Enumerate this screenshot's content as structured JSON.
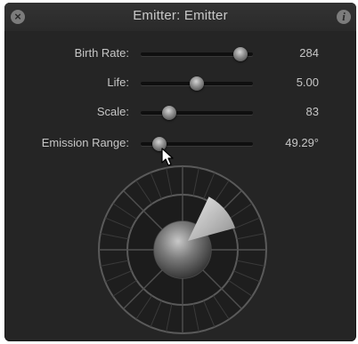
{
  "window": {
    "title": "Emitter: Emitter",
    "close_icon": "close-x-icon",
    "info_icon": "info-icon"
  },
  "params": [
    {
      "id": "birth-rate",
      "label": "Birth Rate:",
      "value": "284",
      "slider_fraction": 0.89
    },
    {
      "id": "life",
      "label": "Life:",
      "value": "5.00",
      "slider_fraction": 0.5
    },
    {
      "id": "scale",
      "label": "Scale:",
      "value": "83",
      "slider_fraction": 0.25
    },
    {
      "id": "emission-range",
      "label": "Emission Range:",
      "value": "49.29°",
      "slider_fraction": 0.17
    }
  ],
  "emission_dial": {
    "range_degrees": 49.29
  },
  "colors": {
    "panel_bg": "#252525",
    "text": "#c6c6c6"
  }
}
